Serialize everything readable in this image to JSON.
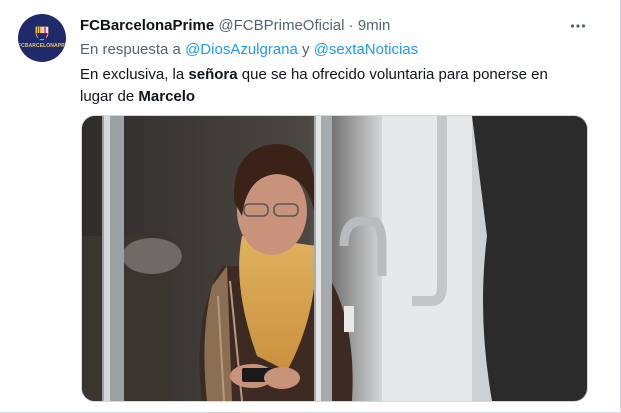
{
  "tweet": {
    "account_name": "FCBarcelonaPrime",
    "handle": "@FCBPrimeOficial",
    "separator": "·",
    "time": "9min",
    "avatar_text": "FCBARCELONAPRIME",
    "reply_prefix": "En respuesta a",
    "mention_1": "@DiosAzulgrana",
    "reply_conjunction": "y",
    "mention_2": "@sextaNoticias",
    "text_part_1": "En exclusiva, la",
    "text_bold_1": "señora",
    "text_part_2": "que se ha ofrecido voluntaria para ponerse en lugar de",
    "text_bold_2": "Marcelo"
  },
  "icons": {
    "more": "more-horizontal-icon",
    "crest": "club-crest-icon"
  },
  "colors": {
    "link": "#1d9bf0",
    "secondary_text": "#536471",
    "primary_text": "#0f1419",
    "avatar_bg": "#1f2a6b"
  }
}
